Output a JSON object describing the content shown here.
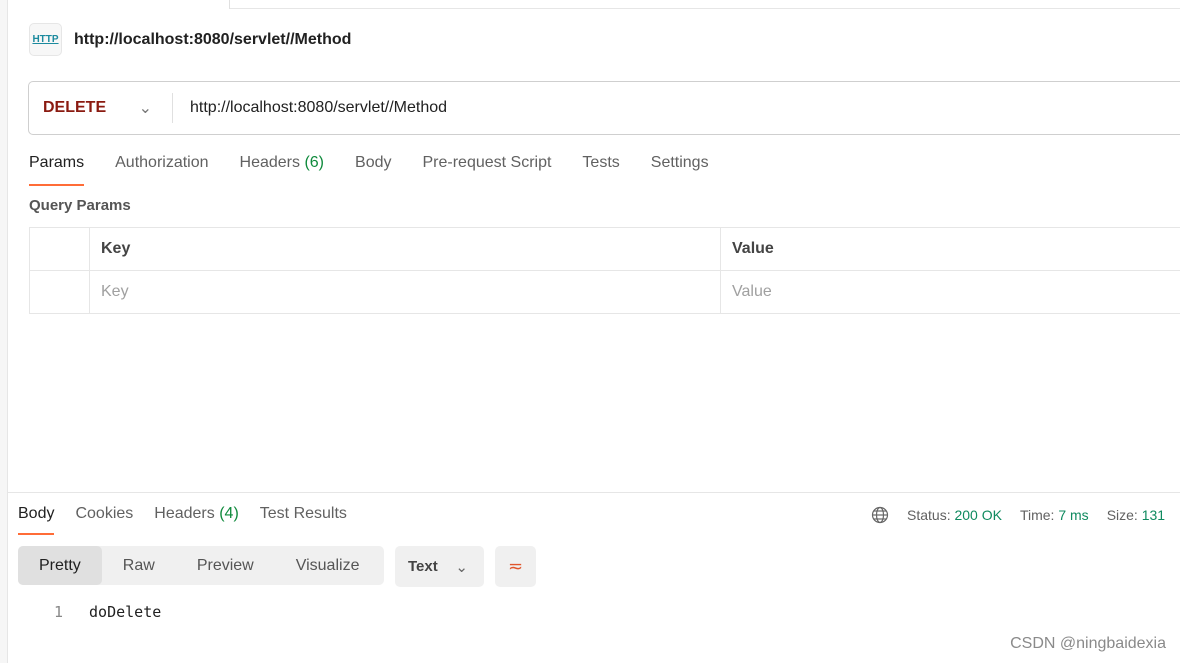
{
  "request": {
    "title": "http://localhost:8080/servlet//Method",
    "method": "DELETE",
    "url": "http://localhost:8080/servlet//Method",
    "icon": "http-icon"
  },
  "tabs": [
    {
      "label": "Params"
    },
    {
      "label": "Authorization"
    },
    {
      "label": "Headers",
      "count": "(6)"
    },
    {
      "label": "Body"
    },
    {
      "label": "Pre-request Script"
    },
    {
      "label": "Tests"
    },
    {
      "label": "Settings"
    }
  ],
  "query_params": {
    "title": "Query Params",
    "headers": [
      "Key",
      "Value"
    ],
    "placeholders": [
      "Key",
      "Value"
    ]
  },
  "response": {
    "tabs": [
      {
        "label": "Body"
      },
      {
        "label": "Cookies"
      },
      {
        "label": "Headers",
        "count": "(4)"
      },
      {
        "label": "Test Results"
      }
    ],
    "status_label": "Status:",
    "status": "200 OK",
    "time_label": "Time:",
    "time": "7 ms",
    "size_label": "Size:",
    "size": "131",
    "views": [
      "Pretty",
      "Raw",
      "Preview",
      "Visualize"
    ],
    "format": "Text",
    "lines": [
      {
        "n": "1",
        "text": "doDelete"
      }
    ]
  },
  "watermark": "CSDN @ningbaidexia",
  "colors": {
    "accent": "#ff6c37",
    "method": "#8a1a10",
    "success": "#0f8a5f"
  }
}
